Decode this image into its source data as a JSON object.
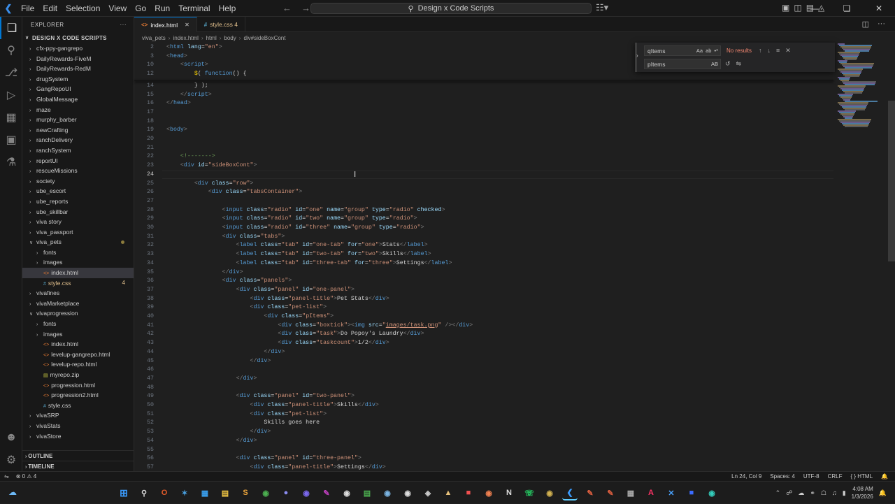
{
  "titlebar": {
    "menu": [
      "File",
      "Edit",
      "Selection",
      "View",
      "Go",
      "Run",
      "Terminal",
      "Help"
    ],
    "search_text": "Design x Code Scripts"
  },
  "explorer": {
    "header": "EXPLORER",
    "project": "DESIGN X CODE SCRIPTS",
    "items": [
      {
        "label": "cfx-ppy-gangrepo",
        "depth": 0,
        "type": "folder-closed"
      },
      {
        "label": "DailyRewards-FiveM",
        "depth": 0,
        "type": "folder-closed"
      },
      {
        "label": "DailyRewards-RedM",
        "depth": 0,
        "type": "folder-closed"
      },
      {
        "label": "drugSystem",
        "depth": 0,
        "type": "folder-closed"
      },
      {
        "label": "GangRepoUI",
        "depth": 0,
        "type": "folder-closed"
      },
      {
        "label": "GlobalMessage",
        "depth": 0,
        "type": "folder-closed"
      },
      {
        "label": "maze",
        "depth": 0,
        "type": "folder-closed"
      },
      {
        "label": "murphy_barber",
        "depth": 0,
        "type": "folder-closed"
      },
      {
        "label": "newCrafting",
        "depth": 0,
        "type": "folder-closed"
      },
      {
        "label": "ranchDelivery",
        "depth": 0,
        "type": "folder-closed"
      },
      {
        "label": "ranchSystem",
        "depth": 0,
        "type": "folder-closed"
      },
      {
        "label": "reportUI",
        "depth": 0,
        "type": "folder-closed"
      },
      {
        "label": "rescueMissions",
        "depth": 0,
        "type": "folder-closed"
      },
      {
        "label": "society",
        "depth": 0,
        "type": "folder-closed"
      },
      {
        "label": "ube_escort",
        "depth": 0,
        "type": "folder-closed"
      },
      {
        "label": "ube_reports",
        "depth": 0,
        "type": "folder-closed"
      },
      {
        "label": "ube_skillbar",
        "depth": 0,
        "type": "folder-closed"
      },
      {
        "label": "viva story",
        "depth": 0,
        "type": "folder-closed"
      },
      {
        "label": "viva_passport",
        "depth": 0,
        "type": "folder-closed"
      },
      {
        "label": "viva_pets",
        "depth": 0,
        "type": "folder-open",
        "modified": true
      },
      {
        "label": "fonts",
        "depth": 1,
        "type": "folder-closed"
      },
      {
        "label": "images",
        "depth": 1,
        "type": "folder-closed"
      },
      {
        "label": "index.html",
        "depth": 1,
        "type": "file",
        "selected": true
      },
      {
        "label": "style.css",
        "depth": 1,
        "type": "file",
        "modified": true,
        "badge": "4"
      },
      {
        "label": "vivafines",
        "depth": 0,
        "type": "folder-closed"
      },
      {
        "label": "vivaMarketplace",
        "depth": 0,
        "type": "folder-closed"
      },
      {
        "label": "vivaprogression",
        "depth": 0,
        "type": "folder-open"
      },
      {
        "label": "fonts",
        "depth": 1,
        "type": "folder-closed"
      },
      {
        "label": "images",
        "depth": 1,
        "type": "folder-closed"
      },
      {
        "label": "index.html",
        "depth": 1,
        "type": "file"
      },
      {
        "label": "levelup-gangrepo.html",
        "depth": 1,
        "type": "file"
      },
      {
        "label": "levelup-repo.html",
        "depth": 1,
        "type": "file"
      },
      {
        "label": "myrepo.zip",
        "depth": 1,
        "type": "file"
      },
      {
        "label": "progression.html",
        "depth": 1,
        "type": "file"
      },
      {
        "label": "progression2.html",
        "depth": 1,
        "type": "file"
      },
      {
        "label": "style.css",
        "depth": 1,
        "type": "file"
      },
      {
        "label": "vivaSRP",
        "depth": 0,
        "type": "folder-closed"
      },
      {
        "label": "vivaStats",
        "depth": 0,
        "type": "folder-closed"
      },
      {
        "label": "vivaStore",
        "depth": 0,
        "type": "folder-closed"
      }
    ],
    "outline": "OUTLINE",
    "timeline": "TIMELINE"
  },
  "tabs": [
    {
      "label": "index.html",
      "active": true,
      "icon": "html"
    },
    {
      "label": "style.css 4",
      "active": false,
      "icon": "css",
      "modified": true
    }
  ],
  "breadcrumbs": [
    "viva_pets",
    "index.html",
    "html",
    "body",
    "div#sideBoxCont"
  ],
  "find": {
    "query": "qItems",
    "replace": "pItems",
    "result": "No results",
    "opts": [
      "Aa",
      "ab",
      "•*"
    ],
    "replace_opts": [
      "AB"
    ]
  },
  "code_lines": [
    {
      "n": "2",
      "h": "<span class='p'>&lt;</span><span class='t'>html</span> <span class='a'>lang</span><span class='w'>=</span><span class='s'>\"en\"</span><span class='p'>&gt;</span>"
    },
    {
      "n": "3",
      "h": "<span class='p'>&lt;</span><span class='t'>head</span><span class='p'>&gt;</span>"
    },
    {
      "n": "10",
      "h": "    <span class='p'>&lt;</span><span class='t'>script</span><span class='p'>&gt;</span>"
    },
    {
      "n": "12",
      "h": "        <span class='y'>$</span><span class='w'>( </span><span class='t'>function</span><span class='w'>() {</span>"
    },
    {
      "n": "14",
      "h": "        <span class='w'>} );</span>"
    },
    {
      "n": "15",
      "h": "    <span class='p'>&lt;/</span><span class='t'>script</span><span class='p'>&gt;</span>"
    },
    {
      "n": "16",
      "h": "<span class='p'>&lt;/</span><span class='t'>head</span><span class='p'>&gt;</span>"
    },
    {
      "n": "17",
      "h": ""
    },
    {
      "n": "18",
      "h": ""
    },
    {
      "n": "19",
      "h": "<span class='p'>&lt;</span><span class='t'>body</span><span class='p'>&gt;</span>"
    },
    {
      "n": "20",
      "h": ""
    },
    {
      "n": "21",
      "h": ""
    },
    {
      "n": "22",
      "h": "    <span class='c'>&lt;!-------&gt;</span>"
    },
    {
      "n": "23",
      "h": "    <span class='p'>&lt;</span><span class='t'>div</span> <span class='a'>id</span><span class='w'>=</span><span class='s'>\"sideBoxCont\"</span><span class='p'>&gt;</span>"
    },
    {
      "n": "24",
      "h": "",
      "cur": true
    },
    {
      "n": "25",
      "h": "        <span class='p'>&lt;</span><span class='t'>div</span> <span class='a'>class</span><span class='w'>=</span><span class='s'>\"row\"</span><span class='p'>&gt;</span>"
    },
    {
      "n": "26",
      "h": "            <span class='p'>&lt;</span><span class='t'>div</span> <span class='a'>class</span><span class='w'>=</span><span class='s'>\"tabsContainer\"</span><span class='p'>&gt;</span>"
    },
    {
      "n": "27",
      "h": ""
    },
    {
      "n": "28",
      "h": "                <span class='p'>&lt;</span><span class='t'>input</span> <span class='a'>class</span><span class='w'>=</span><span class='s'>\"radio\"</span> <span class='a'>id</span><span class='w'>=</span><span class='s'>\"one\"</span> <span class='a'>name</span><span class='w'>=</span><span class='s'>\"group\"</span> <span class='a'>type</span><span class='w'>=</span><span class='s'>\"radio\"</span> <span class='a'>checked</span><span class='p'>&gt;</span>"
    },
    {
      "n": "29",
      "h": "                <span class='p'>&lt;</span><span class='t'>input</span> <span class='a'>class</span><span class='w'>=</span><span class='s'>\"radio\"</span> <span class='a'>id</span><span class='w'>=</span><span class='s'>\"two\"</span> <span class='a'>name</span><span class='w'>=</span><span class='s'>\"group\"</span> <span class='a'>type</span><span class='w'>=</span><span class='s'>\"radio\"</span><span class='p'>&gt;</span>"
    },
    {
      "n": "30",
      "h": "                <span class='p'>&lt;</span><span class='t'>input</span> <span class='a'>class</span><span class='w'>=</span><span class='s'>\"radio\"</span> <span class='a'>id</span><span class='w'>=</span><span class='s'>\"three\"</span> <span class='a'>name</span><span class='w'>=</span><span class='s'>\"group\"</span> <span class='a'>type</span><span class='w'>=</span><span class='s'>\"radio\"</span><span class='p'>&gt;</span>"
    },
    {
      "n": "31",
      "h": "                <span class='p'>&lt;</span><span class='t'>div</span> <span class='a'>class</span><span class='w'>=</span><span class='s'>\"tabs\"</span><span class='p'>&gt;</span>"
    },
    {
      "n": "32",
      "h": "                    <span class='p'>&lt;</span><span class='t'>label</span> <span class='a'>class</span><span class='w'>=</span><span class='s'>\"tab\"</span> <span class='a'>id</span><span class='w'>=</span><span class='s'>\"one-tab\"</span> <span class='a'>for</span><span class='w'>=</span><span class='s'>\"one\"</span><span class='p'>&gt;</span><span class='w'>Stats</span><span class='p'>&lt;/</span><span class='t'>label</span><span class='p'>&gt;</span>"
    },
    {
      "n": "33",
      "h": "                    <span class='p'>&lt;</span><span class='t'>label</span> <span class='a'>class</span><span class='w'>=</span><span class='s'>\"tab\"</span> <span class='a'>id</span><span class='w'>=</span><span class='s'>\"two-tab\"</span> <span class='a'>for</span><span class='w'>=</span><span class='s'>\"two\"</span><span class='p'>&gt;</span><span class='w'>Skills</span><span class='p'>&lt;/</span><span class='t'>label</span><span class='p'>&gt;</span>"
    },
    {
      "n": "34",
      "h": "                    <span class='p'>&lt;</span><span class='t'>label</span> <span class='a'>class</span><span class='w'>=</span><span class='s'>\"tab\"</span> <span class='a'>id</span><span class='w'>=</span><span class='s'>\"three-tab\"</span> <span class='a'>for</span><span class='w'>=</span><span class='s'>\"three\"</span><span class='p'>&gt;</span><span class='w'>Settings</span><span class='p'>&lt;/</span><span class='t'>label</span><span class='p'>&gt;</span>"
    },
    {
      "n": "35",
      "h": "                <span class='p'>&lt;/</span><span class='t'>div</span><span class='p'>&gt;</span>"
    },
    {
      "n": "36",
      "h": "                <span class='p'>&lt;</span><span class='t'>div</span> <span class='a'>class</span><span class='w'>=</span><span class='s'>\"panels\"</span><span class='p'>&gt;</span>"
    },
    {
      "n": "37",
      "h": "                    <span class='p'>&lt;</span><span class='t'>div</span> <span class='a'>class</span><span class='w'>=</span><span class='s'>\"panel\"</span> <span class='a'>id</span><span class='w'>=</span><span class='s'>\"one-panel\"</span><span class='p'>&gt;</span>"
    },
    {
      "n": "38",
      "h": "                        <span class='p'>&lt;</span><span class='t'>div</span> <span class='a'>class</span><span class='w'>=</span><span class='s'>\"panel-title\"</span><span class='p'>&gt;</span><span class='w'>Pet Stats</span><span class='p'>&lt;/</span><span class='t'>div</span><span class='p'>&gt;</span>"
    },
    {
      "n": "39",
      "h": "                        <span class='p'>&lt;</span><span class='t'>div</span> <span class='a'>class</span><span class='w'>=</span><span class='s'>\"pet-list\"</span><span class='p'>&gt;</span>"
    },
    {
      "n": "40",
      "h": "                            <span class='p'>&lt;</span><span class='t'>div</span> <span class='a'>class</span><span class='w'>=</span><span class='s'>\"pItems\"</span><span class='p'>&gt;</span>"
    },
    {
      "n": "41",
      "h": "                                <span class='p'>&lt;</span><span class='t'>div</span> <span class='a'>class</span><span class='w'>=</span><span class='s'>\"boxtick\"</span><span class='p'>&gt;&lt;</span><span class='t'>img</span> <span class='a'>src</span><span class='w'>=</span><span class='s'>\"<u>images/task.png</u>\"</span> <span class='p'>/&gt;&lt;/</span><span class='t'>div</span><span class='p'>&gt;</span>"
    },
    {
      "n": "42",
      "h": "                                <span class='p'>&lt;</span><span class='t'>div</span> <span class='a'>class</span><span class='w'>=</span><span class='s'>\"task\"</span><span class='p'>&gt;</span><span class='w'>Do Popoy's Laundry</span><span class='p'>&lt;/</span><span class='t'>div</span><span class='p'>&gt;</span>"
    },
    {
      "n": "43",
      "h": "                                <span class='p'>&lt;</span><span class='t'>div</span> <span class='a'>class</span><span class='w'>=</span><span class='s'>\"taskcount\"</span><span class='p'>&gt;</span><span class='w'>1/2</span><span class='p'>&lt;/</span><span class='t'>div</span><span class='p'>&gt;</span>"
    },
    {
      "n": "44",
      "h": "                            <span class='p'>&lt;/</span><span class='t'>div</span><span class='p'>&gt;</span>"
    },
    {
      "n": "45",
      "h": "                        <span class='p'>&lt;/</span><span class='t'>div</span><span class='p'>&gt;</span>"
    },
    {
      "n": "46",
      "h": ""
    },
    {
      "n": "47",
      "h": "                    <span class='p'>&lt;/</span><span class='t'>div</span><span class='p'>&gt;</span>"
    },
    {
      "n": "48",
      "h": ""
    },
    {
      "n": "49",
      "h": "                    <span class='p'>&lt;</span><span class='t'>div</span> <span class='a'>class</span><span class='w'>=</span><span class='s'>\"panel\"</span> <span class='a'>id</span><span class='w'>=</span><span class='s'>\"two-panel\"</span><span class='p'>&gt;</span>"
    },
    {
      "n": "50",
      "h": "                        <span class='p'>&lt;</span><span class='t'>div</span> <span class='a'>class</span><span class='w'>=</span><span class='s'>\"panel-title\"</span><span class='p'>&gt;</span><span class='w'>Skills</span><span class='p'>&lt;/</span><span class='t'>div</span><span class='p'>&gt;</span>"
    },
    {
      "n": "51",
      "h": "                        <span class='p'>&lt;</span><span class='t'>div</span> <span class='a'>class</span><span class='w'>=</span><span class='s'>\"pet-list\"</span><span class='p'>&gt;</span>"
    },
    {
      "n": "52",
      "h": "                            <span class='w'>Skills goes here</span>"
    },
    {
      "n": "53",
      "h": "                        <span class='p'>&lt;/</span><span class='t'>div</span><span class='p'>&gt;</span>"
    },
    {
      "n": "54",
      "h": "                    <span class='p'>&lt;/</span><span class='t'>div</span><span class='p'>&gt;</span>"
    },
    {
      "n": "55",
      "h": ""
    },
    {
      "n": "56",
      "h": "                    <span class='p'>&lt;</span><span class='t'>div</span> <span class='a'>class</span><span class='w'>=</span><span class='s'>\"panel\"</span> <span class='a'>id</span><span class='w'>=</span><span class='s'>\"three-panel\"</span><span class='p'>&gt;</span>"
    },
    {
      "n": "57",
      "h": "                        <span class='p'>&lt;</span><span class='t'>div</span> <span class='a'>class</span><span class='w'>=</span><span class='s'>\"panel-title\"</span><span class='p'>&gt;</span><span class='w'>Settings</span><span class='p'>&lt;/</span><span class='t'>div</span><span class='p'>&gt;</span>"
    }
  ],
  "statusbar": {
    "problems": "0",
    "warnings": "4",
    "position": "Ln 24, Col 9",
    "spaces": "Spaces: 4",
    "encoding": "UTF-8",
    "eol": "CRLF",
    "language": "HTML"
  },
  "clock": {
    "time": "4:08 AM",
    "date": "1/3/2026"
  },
  "colors": {
    "accent": "#0078d4",
    "modified": "#e2c08d",
    "error_text": "#f48771"
  }
}
